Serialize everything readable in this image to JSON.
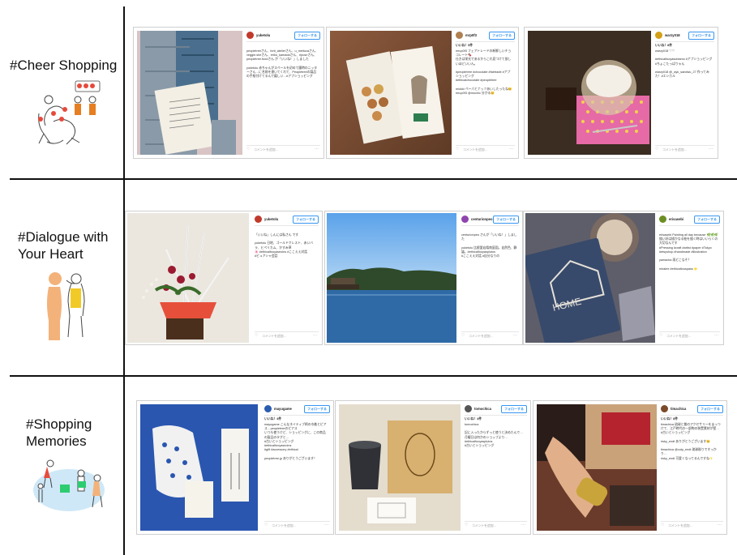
{
  "rows": [
    {
      "label": "#Cheer Shopping"
    },
    {
      "label": "#Dialogue with Your Heart"
    },
    {
      "label": "#Shopping Memories"
    }
  ],
  "posts": [
    {
      "user": "yuketolu",
      "follow": "フォローする",
      "time": "",
      "text": "peopletreeさん、forti_atelierさん、u_meitucaさん、veggie.sheさん、eriko_kamadaさん、ripusnさん、peopletree.foodさん が「いいね！」しました\n\nyuketolu 赤ちゃんがスペールを初めて履時のニッターさん…に名前を書いてくれて、Peopletreeの製品の手紙付けてるんで嬉しい…#アプショッピング",
      "comment": "コメントを追加...",
      "avatar": "#c0392b"
    },
    {
      "user": "mrp0f3",
      "follow": "フォローする",
      "time": "いいね！5件",
      "text": "mrup0f3 フェアトレードの新鮮しいチョコレート🍫\n仕方は栄光であるからこれ見つけて欲しいほどいいん。\n\n#peopletree #chocolate #fairtrade #アプショッピング\n#ethicalchocolate #peopletree\n\nmiokki ペーパとナッツあいしたったね😊\nmrup0f3 @mochic 分かる😊",
      "comment": "コメントを追加...",
      "avatar": "#b08050"
    },
    {
      "user": "warzy018",
      "follow": "フォローする",
      "time": "いいね！8件",
      "text": "warzy018 ♡♡\n\n#ethicalfooyasublamo #アプショッピング\n#ちょこたっぱりゃん\n\nwarzy018 @_ayk_sandwu_27 作ってみた！#エシカル\n",
      "comment": "コメントを追加...",
      "avatar": "#d4a017"
    },
    {
      "user": "yuketolu",
      "follow": "フォローする",
      "time": "",
      "text": "「いいね」しんには私さん です\n\nyuketolu 日地、ゴールドクレスト、赤いバラ、ヒペリカム、かすみ草\n🌸 #ethicalfooyaseoins #ここええ対話\n#ピュアシャ会話",
      "comment": "コメントを追加...",
      "avatar": "#c0392b"
    },
    {
      "user": "centurionpeo",
      "follow": "フォローする",
      "time": "",
      "text": "centurionpeo さんが「いいね！」しました\n\nyuketolu 比叡愛宕県南庭園。自然色、静謐。#ethicalfooyasplutos\n#ここええ対話 #自分なりの",
      "comment": "コメントを追加...",
      "avatar": "#8e44ad"
    },
    {
      "user": "erisasebi",
      "follow": "フォローする",
      "time": "",
      "text": "erisasebi Painting all day because 🌿🌿🌿\n描い好は描かなる絵を描く時はいいらくの大切なんです\n#Pressing #craft #artist #paper #Tokyo #etsyshop #handmade #illustration\n\nyamacha 雨どこなそ？\n\nmiralee #ethicaltouspass 🌟",
      "comment": "コメントを追加...",
      "avatar": "#6b8e23"
    },
    {
      "user": "mayugame",
      "follow": "フォローする",
      "time": "いいね！4件",
      "text": "mayugame こんなネイティブ柄の巾着とピアス…peopletreeのピアス\nいつも使うけど、ショッピングに、この商品の製品のタグと…\n#古いとショッピング\n#ethicalfooyaseoins\n#gift #accessory #ethical\n\npeopletree.jp ありがとうございます！",
      "comment": "コメントを追加...",
      "avatar": "#2a5db0"
    },
    {
      "user": "tomochica",
      "follow": "フォローする",
      "time": "いいね！4件",
      "text": "tomochica\n\n記に入ったからずっと使うと決めたんで…\n月曜日は何かのショップより…\n#ethicalfooyasplutos\n#古いとショッピング",
      "comment": "コメントを追加...",
      "avatar": "#555555"
    },
    {
      "user": "timachica",
      "follow": "フォローする",
      "time": "いいね！8件",
      "text": "timachica 琉球と紫のアクセサリーをまっつけて、江戸時代の一部陶の装置素材が壁…\n#古いとショッピング\n\nrisky_endt ありがとうございます😊\n\ntimachica @cuty_endt 琉球彫りですっかり…\nrisky_endt 可愛くなってるんですね✨",
      "comment": "コメントを追加...",
      "avatar": "#7a4a2a"
    }
  ]
}
